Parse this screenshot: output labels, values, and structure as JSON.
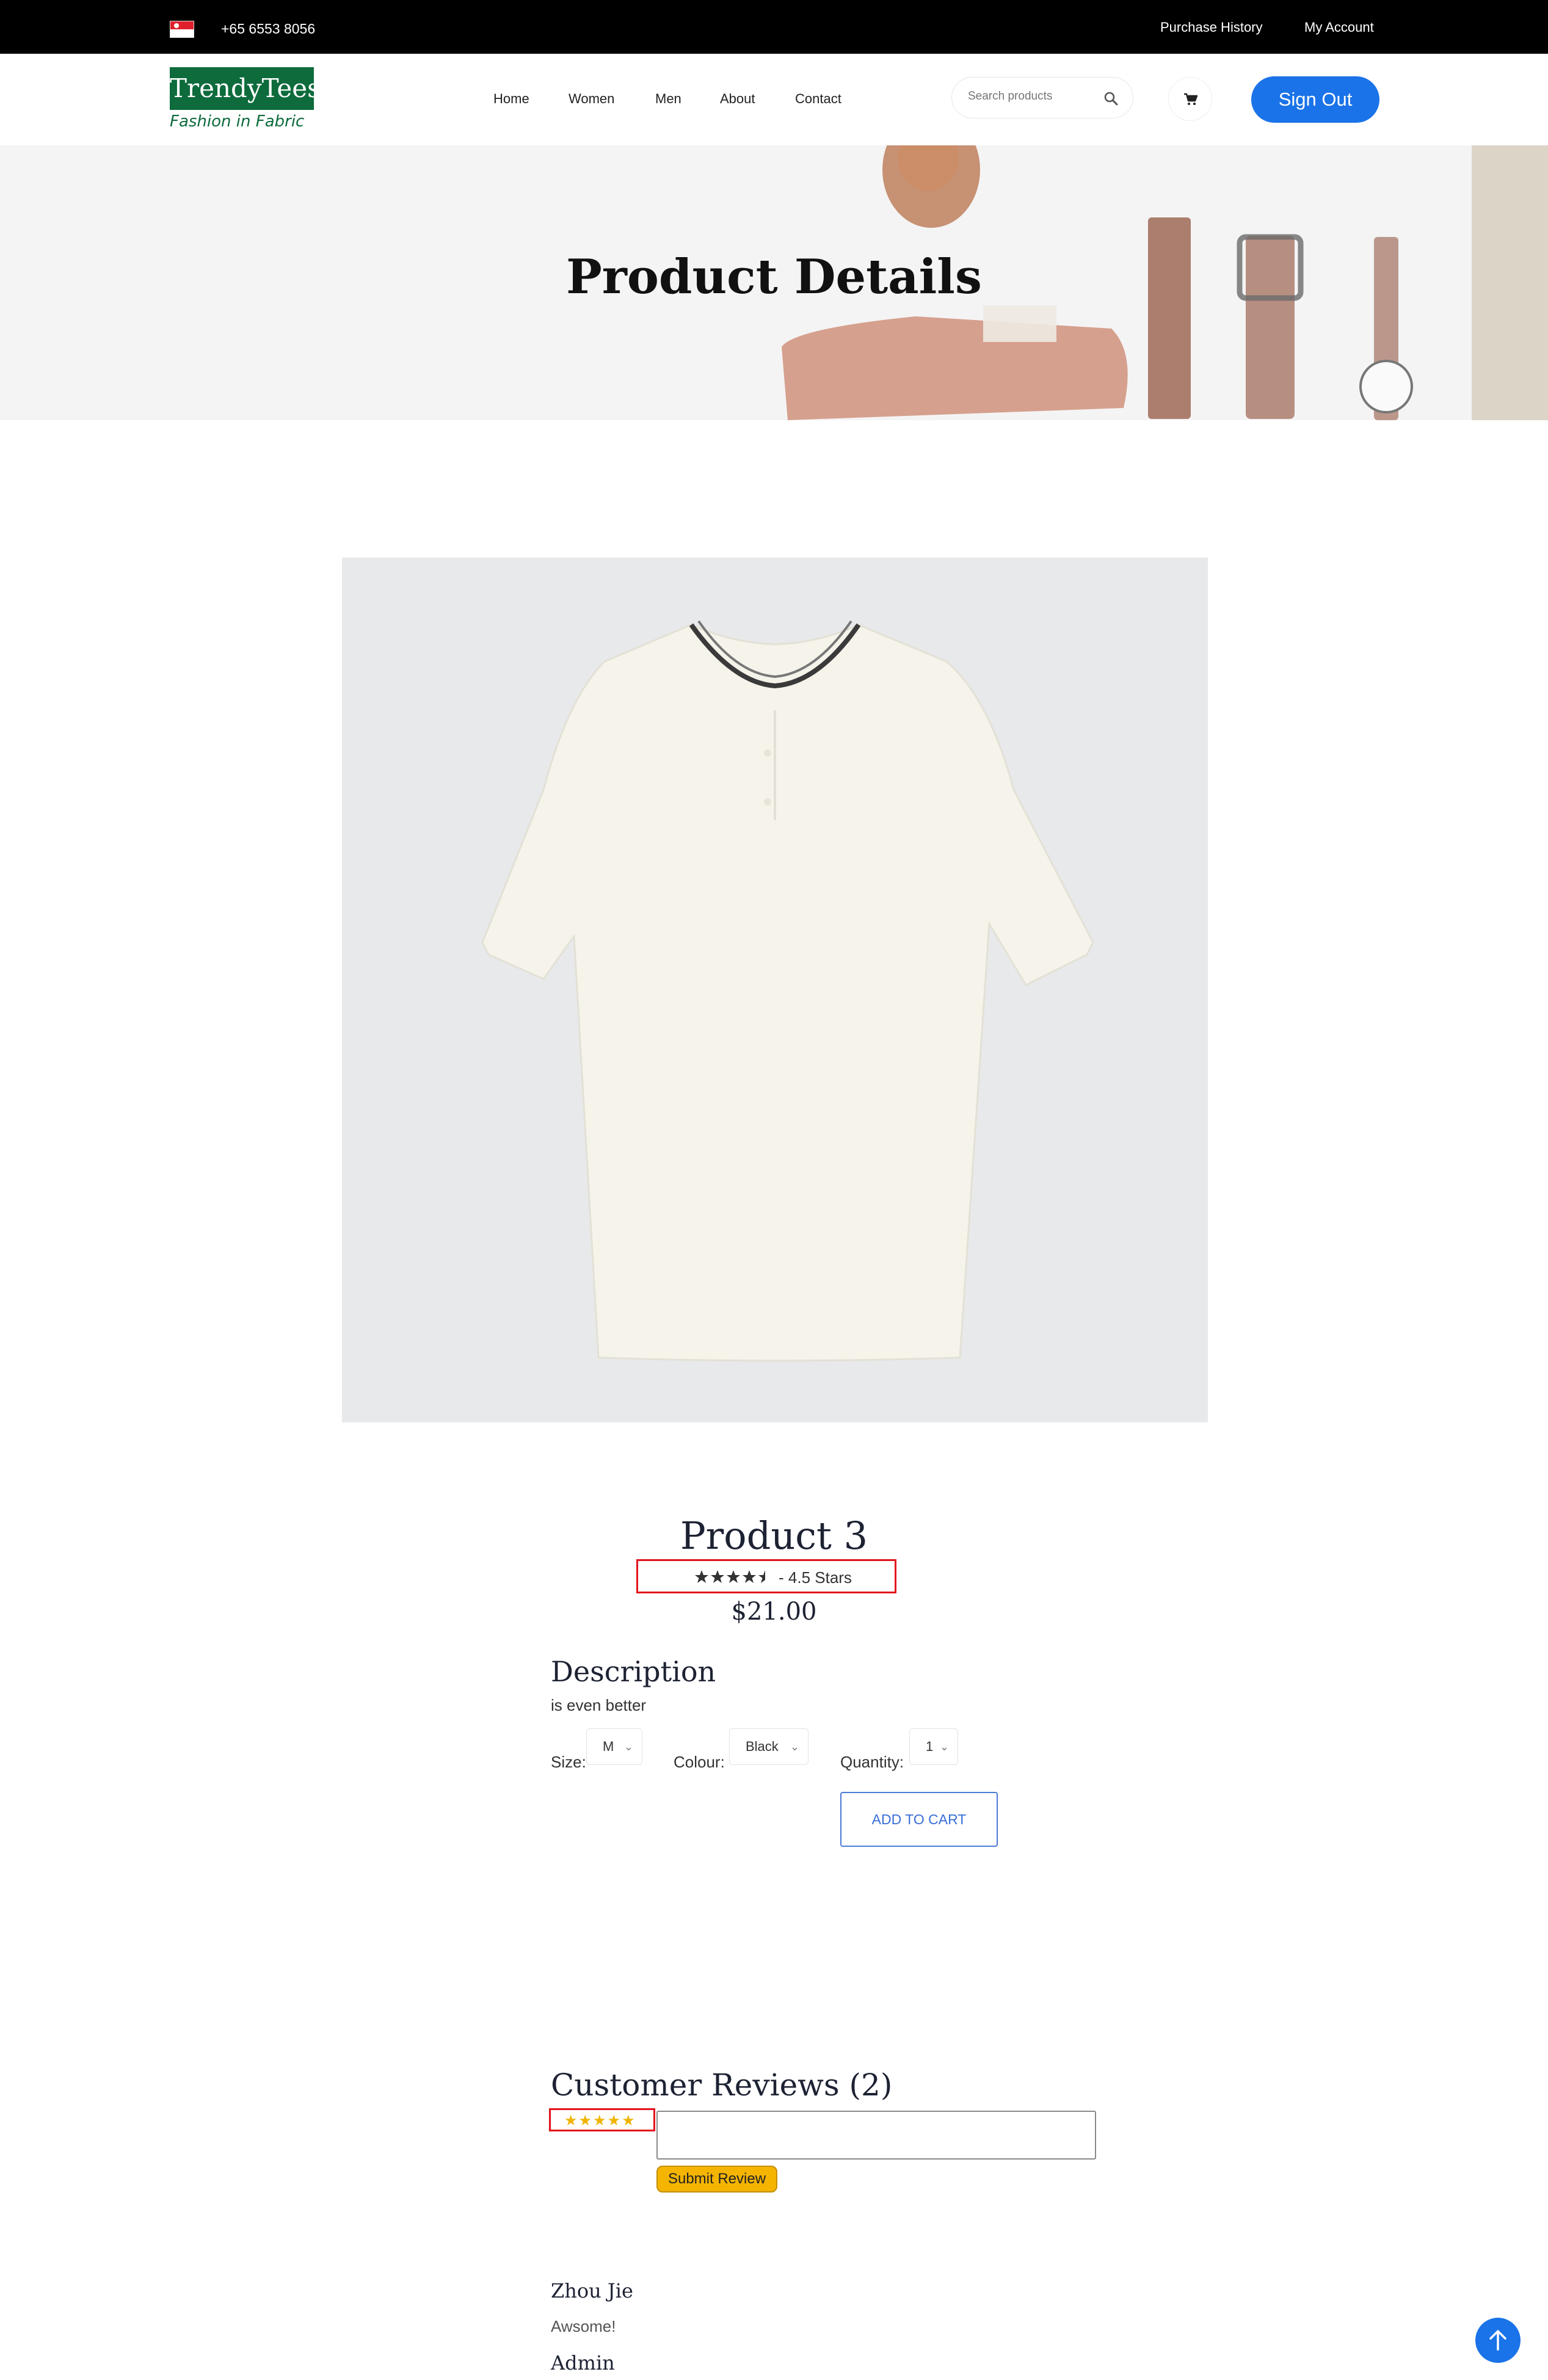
{
  "topbar": {
    "phone": "+65 6553 8056",
    "links": [
      "Purchase History",
      "My Account"
    ]
  },
  "header": {
    "logo_title": "TrendyTees",
    "logo_tagline": "Fashion in Fabric",
    "nav": [
      "Home",
      "Women",
      "Men",
      "About",
      "Contact"
    ],
    "search_placeholder": "Search products",
    "sign_out_label": "Sign Out"
  },
  "banner": {
    "title": "Product Details"
  },
  "product": {
    "name": "Product 3",
    "rating": 4.5,
    "rating_label": "- 4.5 Stars",
    "price": "$21.00",
    "description_title": "Description",
    "description": "is even better",
    "size_label": "Size:",
    "size_value": "M",
    "colour_label": "Colour:",
    "colour_value": "Black",
    "quantity_label": "Quantity:",
    "quantity_value": "1",
    "add_to_cart_label": "ADD TO CART"
  },
  "reviews": {
    "title": "Customer Reviews (2)",
    "stars": "★★★★★",
    "submit_label": "Submit Review",
    "items": [
      {
        "author": "Zhou Jie",
        "text": "Awsome!"
      },
      {
        "author": "Admin",
        "text": ""
      }
    ]
  },
  "colors": {
    "accent": "#1a73e8",
    "logo_green": "#0d6b3c",
    "highlight_red": "#e3121b",
    "submit_yellow": "#f4b400"
  }
}
